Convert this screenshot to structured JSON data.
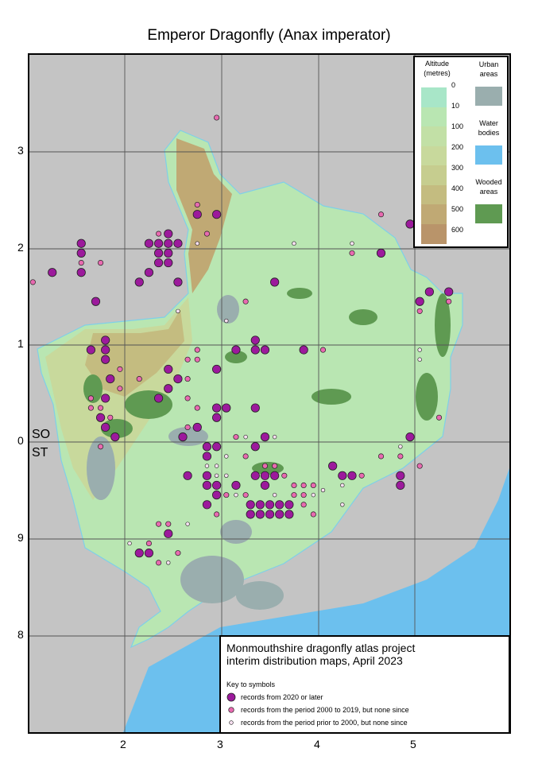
{
  "title": "Emperor Dragonfly (Anax imperator)",
  "axes": {
    "x_ticks": [
      "2",
      "3",
      "4",
      "5"
    ],
    "y_ticks": [
      "3",
      "2",
      "1",
      "0",
      "9",
      "8"
    ],
    "grid_labels": [
      "SO",
      "ST"
    ]
  },
  "legend": {
    "altitude_title_1": "Altitude",
    "altitude_title_2": "(metres)",
    "altitude_levels": [
      "0",
      "10",
      "100",
      "200",
      "300",
      "400",
      "500",
      "600"
    ],
    "altitude_colors": [
      "#a8e6c8",
      "#b9e6b2",
      "#c2e0a6",
      "#c8d99c",
      "#c6cd8f",
      "#c4bc80",
      "#c0a974",
      "#b9946a"
    ],
    "urban_1": "Urban",
    "urban_2": "areas",
    "urban_color": "#9aaeae",
    "water_1": "Water",
    "water_2": "bodies",
    "water_color": "#6cc0ee",
    "wooded_1": "Wooded",
    "wooded_2": "areas",
    "wooded_color": "#5f9a52"
  },
  "key": {
    "line1": "Monmouthshire dragonfly atlas project",
    "line2": "interim distribution maps, April 2023",
    "heading": "Key to symbols",
    "symbols": [
      {
        "label": "records from 2020 or later",
        "color": "#9c1a9c"
      },
      {
        "label": "records from the period 2000 to 2019, but none since",
        "color": "#e86ab0"
      },
      {
        "label": "records from the period prior to 2000, but none since",
        "color": "#f6dff0"
      }
    ]
  },
  "records": {
    "recent": [
      [
        1.55,
        1.05
      ],
      [
        1.55,
        0.95
      ],
      [
        1.55,
        0.75
      ],
      [
        1.25,
        0.75
      ],
      [
        1.7,
        0.45
      ],
      [
        1.65,
        -0.05
      ],
      [
        1.8,
        -0.05
      ],
      [
        1.8,
        0.05
      ],
      [
        1.8,
        -0.15
      ],
      [
        1.85,
        -0.35
      ],
      [
        1.8,
        -0.55
      ],
      [
        1.75,
        -0.75
      ],
      [
        1.8,
        -0.85
      ],
      [
        1.9,
        -0.95
      ],
      [
        2.25,
        1.05
      ],
      [
        2.35,
        1.05
      ],
      [
        2.45,
        1.05
      ],
      [
        2.55,
        1.05
      ],
      [
        2.45,
        1.15
      ],
      [
        2.35,
        0.95
      ],
      [
        2.45,
        0.95
      ],
      [
        2.35,
        0.85
      ],
      [
        2.45,
        0.85
      ],
      [
        2.25,
        0.75
      ],
      [
        2.15,
        0.65
      ],
      [
        2.55,
        0.65
      ],
      [
        2.75,
        1.35
      ],
      [
        2.95,
        1.35
      ],
      [
        2.45,
        -0.25
      ],
      [
        2.55,
        -0.35
      ],
      [
        2.45,
        -0.45
      ],
      [
        2.35,
        -0.55
      ],
      [
        2.6,
        -0.95
      ],
      [
        2.95,
        -0.25
      ],
      [
        2.95,
        -0.65
      ],
      [
        2.95,
        -0.75
      ],
      [
        3.05,
        -0.65
      ],
      [
        2.75,
        -0.85
      ],
      [
        2.85,
        -1.05
      ],
      [
        2.85,
        -1.15
      ],
      [
        2.95,
        -1.05
      ],
      [
        2.65,
        -1.35
      ],
      [
        2.85,
        -1.35
      ],
      [
        2.85,
        -1.45
      ],
      [
        2.95,
        -1.45
      ],
      [
        2.95,
        -1.55
      ],
      [
        2.85,
        -1.65
      ],
      [
        3.15,
        -1.45
      ],
      [
        3.35,
        -0.65
      ],
      [
        3.35,
        -1.05
      ],
      [
        3.45,
        -0.95
      ],
      [
        3.35,
        -1.35
      ],
      [
        3.45,
        -1.35
      ],
      [
        3.55,
        -1.35
      ],
      [
        3.45,
        -1.45
      ],
      [
        3.3,
        -1.65
      ],
      [
        3.4,
        -1.65
      ],
      [
        3.5,
        -1.65
      ],
      [
        3.6,
        -1.65
      ],
      [
        3.7,
        -1.65
      ],
      [
        3.3,
        -1.75
      ],
      [
        3.4,
        -1.75
      ],
      [
        3.5,
        -1.75
      ],
      [
        3.6,
        -1.75
      ],
      [
        3.7,
        -1.75
      ],
      [
        3.35,
        -0.05
      ],
      [
        3.45,
        -0.05
      ],
      [
        3.15,
        -0.05
      ],
      [
        3.55,
        0.65
      ],
      [
        3.85,
        -0.05
      ],
      [
        4.15,
        -1.25
      ],
      [
        4.25,
        -1.35
      ],
      [
        4.35,
        -1.35
      ],
      [
        4.65,
        0.95
      ],
      [
        4.95,
        1.25
      ],
      [
        5.15,
        1.35
      ],
      [
        5.05,
        0.45
      ],
      [
        5.15,
        0.55
      ],
      [
        5.35,
        0.55
      ],
      [
        4.95,
        -0.95
      ],
      [
        4.85,
        -1.35
      ],
      [
        4.85,
        -1.45
      ],
      [
        2.45,
        -1.95
      ],
      [
        2.15,
        -2.15
      ],
      [
        2.25,
        -2.15
      ],
      [
        3.35,
        0.05
      ]
    ],
    "mid": [
      [
        1.05,
        0.65
      ],
      [
        1.55,
        0.85
      ],
      [
        1.75,
        0.85
      ],
      [
        2.75,
        1.45
      ],
      [
        2.85,
        1.15
      ],
      [
        2.35,
        1.15
      ],
      [
        2.95,
        2.35
      ],
      [
        4.65,
        1.35
      ],
      [
        5.25,
        1.35
      ],
      [
        5.25,
        1.55
      ],
      [
        5.15,
        1.25
      ],
      [
        5.05,
        0.35
      ],
      [
        5.35,
        0.45
      ],
      [
        2.65,
        -0.15
      ],
      [
        2.75,
        -0.15
      ],
      [
        2.65,
        -0.35
      ],
      [
        2.75,
        -0.05
      ],
      [
        2.65,
        -0.55
      ],
      [
        2.15,
        -0.35
      ],
      [
        1.95,
        -0.25
      ],
      [
        1.95,
        -0.45
      ],
      [
        1.65,
        -0.55
      ],
      [
        1.75,
        -0.65
      ],
      [
        1.65,
        -0.65
      ],
      [
        1.85,
        -0.75
      ],
      [
        1.75,
        -1.05
      ],
      [
        2.75,
        -0.65
      ],
      [
        2.65,
        -0.85
      ],
      [
        3.15,
        -0.95
      ],
      [
        3.25,
        -1.15
      ],
      [
        3.45,
        -1.25
      ],
      [
        3.55,
        -1.25
      ],
      [
        3.65,
        -1.35
      ],
      [
        3.75,
        -1.45
      ],
      [
        3.85,
        -1.45
      ],
      [
        3.75,
        -1.55
      ],
      [
        3.85,
        -1.55
      ],
      [
        3.95,
        -1.45
      ],
      [
        3.25,
        -1.55
      ],
      [
        3.85,
        -1.65
      ],
      [
        3.95,
        -1.75
      ],
      [
        2.95,
        -1.75
      ],
      [
        3.05,
        -1.55
      ],
      [
        2.35,
        -1.85
      ],
      [
        2.45,
        -1.85
      ],
      [
        2.25,
        -2.05
      ],
      [
        2.35,
        -2.25
      ],
      [
        3.25,
        0.45
      ],
      [
        4.05,
        -0.05
      ],
      [
        4.35,
        0.95
      ],
      [
        5.25,
        -0.75
      ],
      [
        4.45,
        -1.35
      ],
      [
        4.65,
        -1.15
      ],
      [
        4.85,
        -1.15
      ],
      [
        5.05,
        -1.25
      ],
      [
        2.55,
        -2.15
      ]
    ],
    "old": [
      [
        2.75,
        1.05
      ],
      [
        2.55,
        0.35
      ],
      [
        3.05,
        0.25
      ],
      [
        3.75,
        1.05
      ],
      [
        4.35,
        1.05
      ],
      [
        5.05,
        -0.05
      ],
      [
        5.05,
        -0.15
      ],
      [
        4.25,
        -1.45
      ],
      [
        4.05,
        -1.5
      ],
      [
        4.25,
        -1.65
      ],
      [
        2.95,
        -1.25
      ],
      [
        2.85,
        -1.25
      ],
      [
        3.05,
        -1.35
      ],
      [
        2.95,
        -1.35
      ],
      [
        3.15,
        -1.55
      ],
      [
        3.25,
        -1.55
      ],
      [
        2.45,
        -2.25
      ],
      [
        2.05,
        -2.05
      ],
      [
        2.65,
        -1.85
      ],
      [
        3.05,
        -1.15
      ],
      [
        3.55,
        -1.55
      ],
      [
        3.95,
        -1.55
      ],
      [
        4.85,
        -1.05
      ],
      [
        3.55,
        -0.95
      ],
      [
        3.25,
        -0.95
      ]
    ]
  }
}
